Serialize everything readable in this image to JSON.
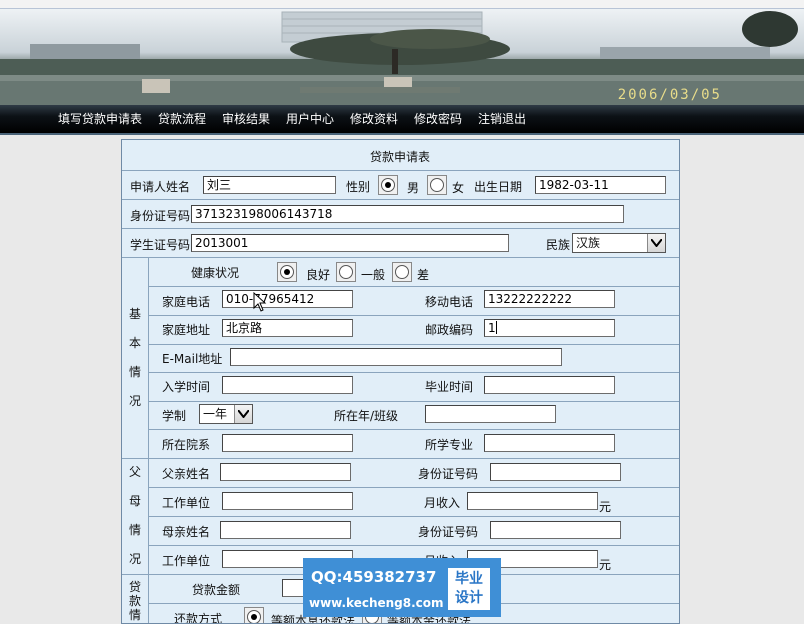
{
  "banner": {
    "date": "2006/03/05"
  },
  "nav": {
    "items": [
      "填写贷款申请表",
      "贷款流程",
      "审核结果",
      "用户中心",
      "修改资料",
      "修改密码",
      "注销退出"
    ]
  },
  "form": {
    "title": "贷款申请表",
    "applicant_name_label": "申请人姓名",
    "applicant_name": "刘三",
    "gender_label": "性别",
    "gender_options": [
      "男",
      "女"
    ],
    "gender_selected": "男",
    "birthdate_label": "出生日期",
    "birthdate": "1982-03-11",
    "id_number_label": "身份证号码",
    "id_number": "371323198006143718",
    "student_id_label": "学生证号码",
    "student_id": "2013001",
    "ethnicity_label": "民族",
    "ethnicity": "汉族",
    "basic_section_label": [
      "基",
      "本",
      "情",
      "况"
    ],
    "health_label": "健康状况",
    "health_options": [
      "良好",
      "一般",
      "差"
    ],
    "health_selected": "良好",
    "home_phone_label": "家庭电话",
    "home_phone": "010-77965412",
    "mobile_label": "移动电话",
    "mobile": "13222222222",
    "address_label": "家庭地址",
    "address": "北京路",
    "postcode_label": "邮政编码",
    "postcode": "1",
    "email_label": "E-Mail地址",
    "email": "",
    "enroll_label": "入学时间",
    "enroll": "",
    "graduate_label": "毕业时间",
    "graduate": "",
    "schooling_label": "学制",
    "schooling": "一年",
    "grade_class_label": "所在年/班级",
    "grade_class": "",
    "college_label": "所在院系",
    "college": "",
    "major_label": "所学专业",
    "major": "",
    "parents_section_label": [
      "父",
      "母",
      "情",
      "况"
    ],
    "father_name_label": "父亲姓名",
    "father_id_label": "身份证号码",
    "work_unit_label": "工作单位",
    "monthly_income_label": "月收入",
    "currency_unit": "元",
    "mother_name_label": "母亲姓名",
    "mother_id_label": "身份证号码",
    "mother_work_label": "工作单位",
    "mother_income_label": "月收入",
    "loan_section_label": [
      "贷",
      "款",
      "情"
    ],
    "loan_amount_label": "贷款金额",
    "repay_label": "还款方式",
    "repay_option_1": "等额本息还款法",
    "repay_option_2": "等额本金还款法"
  },
  "watermark": {
    "qq": "QQ:459382737",
    "url": "www.kecheng8.com",
    "badge_line1": "毕业",
    "badge_line2": "设计"
  }
}
